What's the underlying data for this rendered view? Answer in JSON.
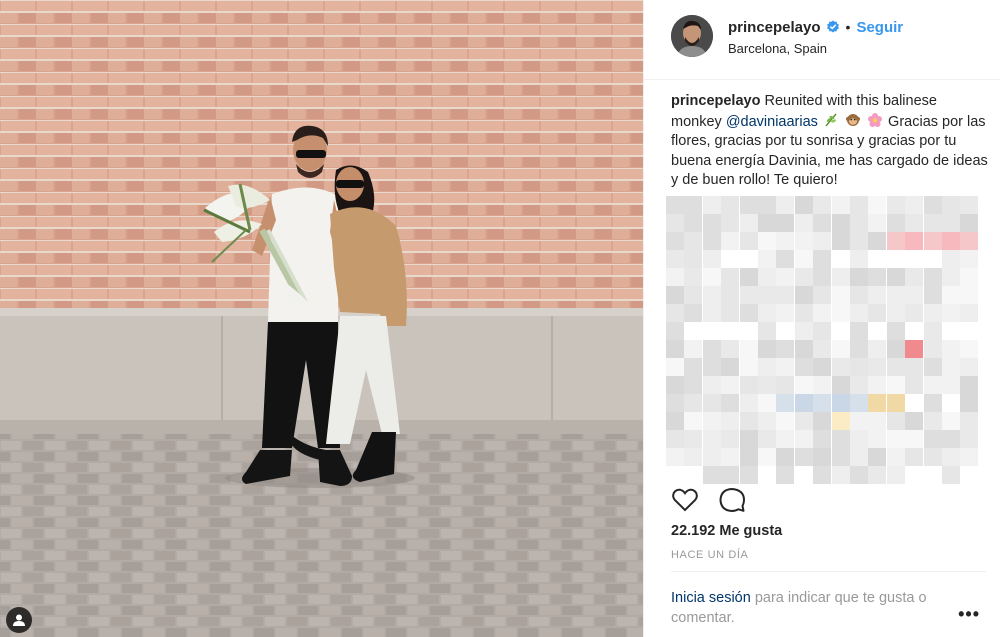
{
  "post": {
    "username": "princepelayo",
    "follow_label": "Seguir",
    "separator": "•",
    "location": "Barcelona, Spain",
    "caption_prefix": "Reunited with this balinese monkey",
    "mention": "@daviniaarias",
    "caption_body": "Gracias por las flores, gracias por tu sonrisa y gracias por tu buena energía Davinia, me has cargado de ideas y de buen rollo! Te quiero!",
    "likes": "22.192 Me gusta",
    "timestamp": "HACE UN DÍA",
    "login_link": "Inicia sesión",
    "login_text": "para indicar que te gusta o comentar.",
    "more_label": "•••"
  },
  "icons": {
    "verified": "verified-badge-icon",
    "heart": "heart-icon",
    "comment": "comment-icon",
    "user_tag": "user-tag-icon",
    "emojis": [
      "herb-emoji",
      "monkey-emoji",
      "blossom-emoji"
    ]
  },
  "colors": {
    "accent": "#3897f0",
    "mention": "#003569",
    "muted": "#999999",
    "text": "#262626"
  }
}
